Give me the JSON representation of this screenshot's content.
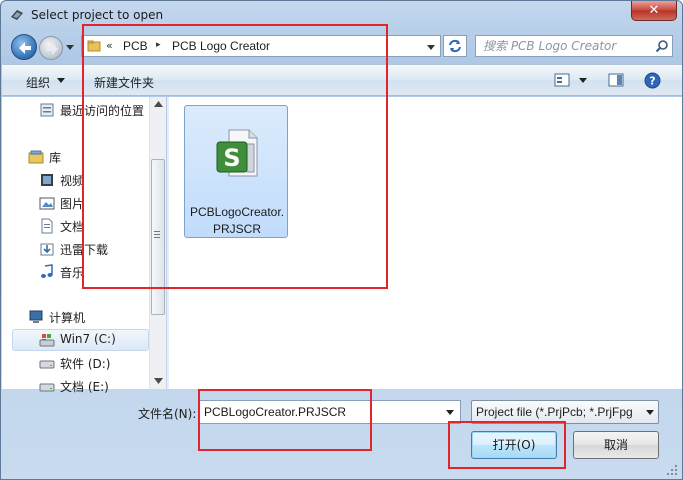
{
  "window": {
    "title": "Select project to open",
    "close_label": "✕"
  },
  "address": {
    "chevron": "«",
    "crumbs": [
      "PCB",
      "PCB Logo Creator"
    ],
    "separator": "▸"
  },
  "search": {
    "placeholder": "搜索 PCB Logo Creator"
  },
  "toolbar": {
    "organize_label": "组织",
    "new_folder_label": "新建文件夹"
  },
  "nav": {
    "items": [
      {
        "label": "最近访问的位置",
        "icon": "recent-places-icon"
      },
      {
        "label": "库",
        "icon": "library-icon"
      },
      {
        "label": "视频",
        "icon": "video-icon"
      },
      {
        "label": "图片",
        "icon": "pictures-icon"
      },
      {
        "label": "文档",
        "icon": "documents-icon"
      },
      {
        "label": "迅雷下载",
        "icon": "download-icon"
      },
      {
        "label": "音乐",
        "icon": "music-icon"
      },
      {
        "label": "计算机",
        "icon": "computer-icon"
      },
      {
        "label": "Win7 (C:)",
        "icon": "drive-c-icon"
      },
      {
        "label": "软件 (D:)",
        "icon": "drive-icon"
      },
      {
        "label": "文档 (E:)",
        "icon": "drive-icon"
      }
    ],
    "selected": "Win7 (C:)"
  },
  "files": [
    {
      "name": "PCBLogoCreator.PRJSCR",
      "icon": "script-project-icon",
      "selected": true
    }
  ],
  "bottom": {
    "filename_label": "文件名(N):",
    "filename_value": "PCBLogoCreator.PRJSCR",
    "filter_value": "Project file (*.PrjPcb; *.PrjFpg",
    "open_label": "打开(O)",
    "cancel_label": "取消"
  },
  "colors": {
    "annotation": "#e0262a",
    "selection": "#c1dcfb"
  }
}
